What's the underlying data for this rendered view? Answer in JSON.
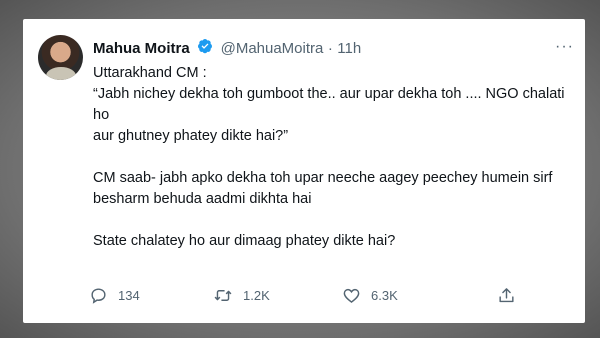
{
  "tweet": {
    "author_name": "Mahua Moitra",
    "handle": "@MahuaMoitra",
    "separator": "·",
    "time": "11h",
    "more_label": "···",
    "lines": [
      "Uttarakhand CM :",
      "“Jabh nichey dekha toh gumboot the.. aur upar dekha toh .... NGO chalati ho",
      "aur ghutney phatey dikte hai?”",
      "",
      "CM saab- jabh apko dekha toh upar neeche aagey peechey humein sirf",
      "besharm behuda aadmi dikhta hai",
      "",
      "State chalatey ho aur dimaag phatey dikte hai?"
    ],
    "replies": "134",
    "retweets": "1.2K",
    "likes": "6.3K"
  },
  "colors": {
    "text": "#0f1419",
    "secondary": "#536471",
    "verified": "#1d9bf0",
    "backdrop": "#7b7b7b"
  },
  "icons": [
    "verified-badge-icon",
    "more-icon",
    "reply-icon",
    "retweet-icon",
    "like-icon",
    "share-icon"
  ]
}
